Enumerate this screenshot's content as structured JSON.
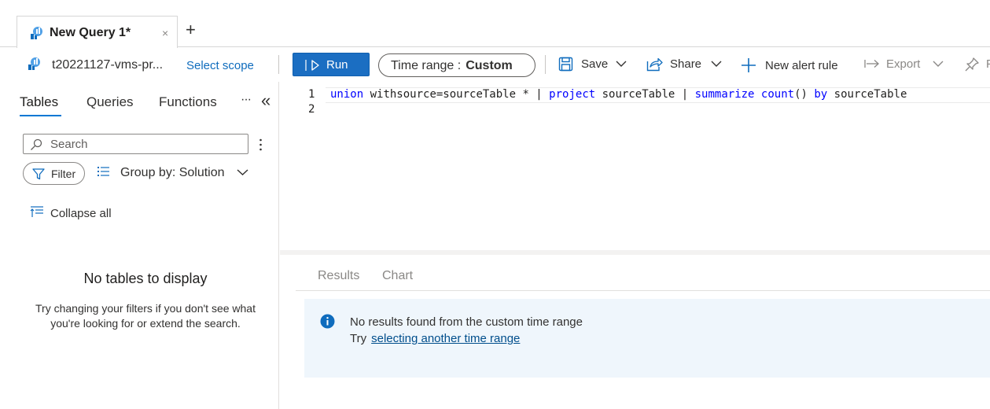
{
  "tabs": {
    "active_title": "New Query 1*",
    "close_glyph": "×",
    "add_glyph": "+"
  },
  "toolbar": {
    "workspace_name": "t20221127-vms-pr...",
    "select_scope": "Select scope",
    "run_label": "Run",
    "time_range_label": "Time range :",
    "time_range_value": "Custom",
    "save_label": "Save",
    "share_label": "Share",
    "new_alert_label": "New alert rule",
    "export_label": "Export",
    "pin_label": "P"
  },
  "sidebar": {
    "tabs": [
      "Tables",
      "Queries",
      "Functions"
    ],
    "more_glyph": "···",
    "collapse_glyph": "«",
    "search_placeholder": "Search",
    "filter_label": "Filter",
    "group_by_label": "Group by: Solution",
    "collapse_all_label": "Collapse all",
    "empty_title": "No tables to display",
    "empty_description": "Try changing your filters if you don't see what you're looking for or extend the search."
  },
  "editor": {
    "line_numbers": [
      "1",
      "2"
    ],
    "tokens": [
      {
        "t": "union",
        "c": "kw"
      },
      {
        "t": " withsource=sourceTable * | ",
        "c": ""
      },
      {
        "t": "project",
        "c": "kw"
      },
      {
        "t": " sourceTable | ",
        "c": ""
      },
      {
        "t": "summarize",
        "c": "kw"
      },
      {
        "t": " ",
        "c": ""
      },
      {
        "t": "count",
        "c": "fn"
      },
      {
        "t": "() ",
        "c": ""
      },
      {
        "t": "by",
        "c": "kw"
      },
      {
        "t": " sourceTable",
        "c": ""
      }
    ]
  },
  "results": {
    "tabs": [
      "Results",
      "Chart"
    ],
    "message": "No results found from the custom time range",
    "try_prefix": "Try",
    "try_link": "selecting another time range"
  },
  "colors": {
    "accent": "#0078d4",
    "run_button": "#1b6ec2",
    "info_background": "#eff6fc",
    "info_icon": "#0f6cbd",
    "link": "#004e8c"
  }
}
